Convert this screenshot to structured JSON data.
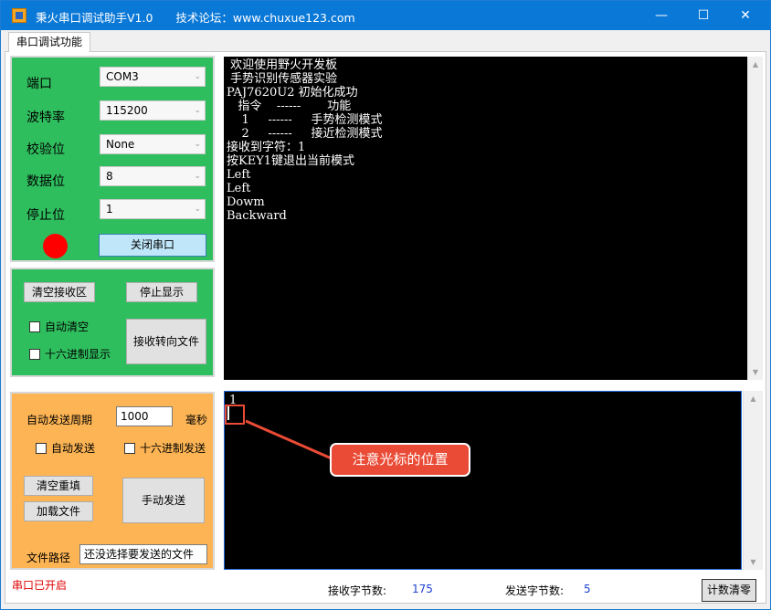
{
  "window": {
    "title": "秉火串口调试助手V1.0　　技术论坛：www.chuxue123.com",
    "min_icon": "—",
    "max_icon": "☐",
    "close_icon": "✕"
  },
  "tab": {
    "label": "串口调试功能"
  },
  "port_settings": {
    "port_label": "端口",
    "port_value": "COM3",
    "baud_label": "波特率",
    "baud_value": "115200",
    "parity_label": "校验位",
    "parity_value": "None",
    "databits_label": "数据位",
    "databits_value": "8",
    "stopbits_label": "停止位",
    "stopbits_value": "1",
    "combo_arrow": "⌄",
    "led_color": "#ff0000",
    "close_port_label": "关闭串口"
  },
  "receive_panel": {
    "clear_label": "清空接收区",
    "stop_display_label": "停止显示",
    "auto_clear_label": "自动清空",
    "hex_display_label": "十六进制显示",
    "redirect_label": "接收转向文件"
  },
  "send_panel": {
    "period_label": "自动发送周期",
    "period_value": "1000",
    "period_unit": "毫秒",
    "auto_send_label": "自动发送",
    "hex_send_label": "十六进制发送",
    "clear_refill_label": "清空重填",
    "load_file_label": "加载文件",
    "manual_send_label": "手动发送",
    "file_path_label": "文件路径",
    "file_path_value": "还没选择要发送的文件"
  },
  "receive_text": [
    " 欢迎使用野火开发板",
    " 手势识别传感器实验",
    "PAJ7620U2 初始化成功",
    "   指令    ------       功能",
    "    1     ------     手势检测模式",
    "    2     ------     接近检测模式",
    "接收到字符：1",
    "按KEY1键退出当前模式",
    "Left",
    "Left",
    "Dowm",
    "Backward"
  ],
  "send_text": "1",
  "annotation": {
    "callout_text": "注意光标的位置"
  },
  "status_bar": {
    "port_status": "串口已开启",
    "recv_bytes_label": "接收字节数:",
    "recv_bytes_value": "175",
    "send_bytes_label": "发送字节数:",
    "send_bytes_value": "5",
    "reset_label": "计数清零"
  },
  "colors": {
    "titlebar": "#0a78d7",
    "settings_panel": "#2fbe5e",
    "send_panel": "#fcb454",
    "annotation": "#ea4b36",
    "count_value": "#1a3fd0"
  }
}
